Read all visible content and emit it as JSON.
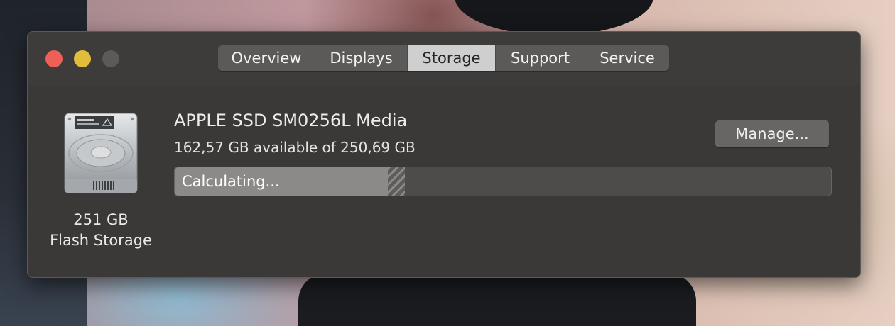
{
  "window": {
    "tabs": [
      {
        "label": "Overview",
        "active": false
      },
      {
        "label": "Displays",
        "active": false
      },
      {
        "label": "Storage",
        "active": true
      },
      {
        "label": "Support",
        "active": false
      },
      {
        "label": "Service",
        "active": false
      }
    ]
  },
  "storage": {
    "icon": "ssd-drive-icon",
    "capacity": "251 GB",
    "type": "Flash Storage",
    "disk_name": "APPLE SSD SM0256L Media",
    "availability": "162,57 GB available of 250,69 GB",
    "usage_status": "Calculating...",
    "usage_fraction": 0.325,
    "manage_label": "Manage..."
  },
  "colors": {
    "close": "#ed5f57",
    "minimize": "#e2bd3b",
    "zoom_disabled": "#5b5a59",
    "window_bg": "#3a3938",
    "active_tab": "#cfcfcf"
  }
}
